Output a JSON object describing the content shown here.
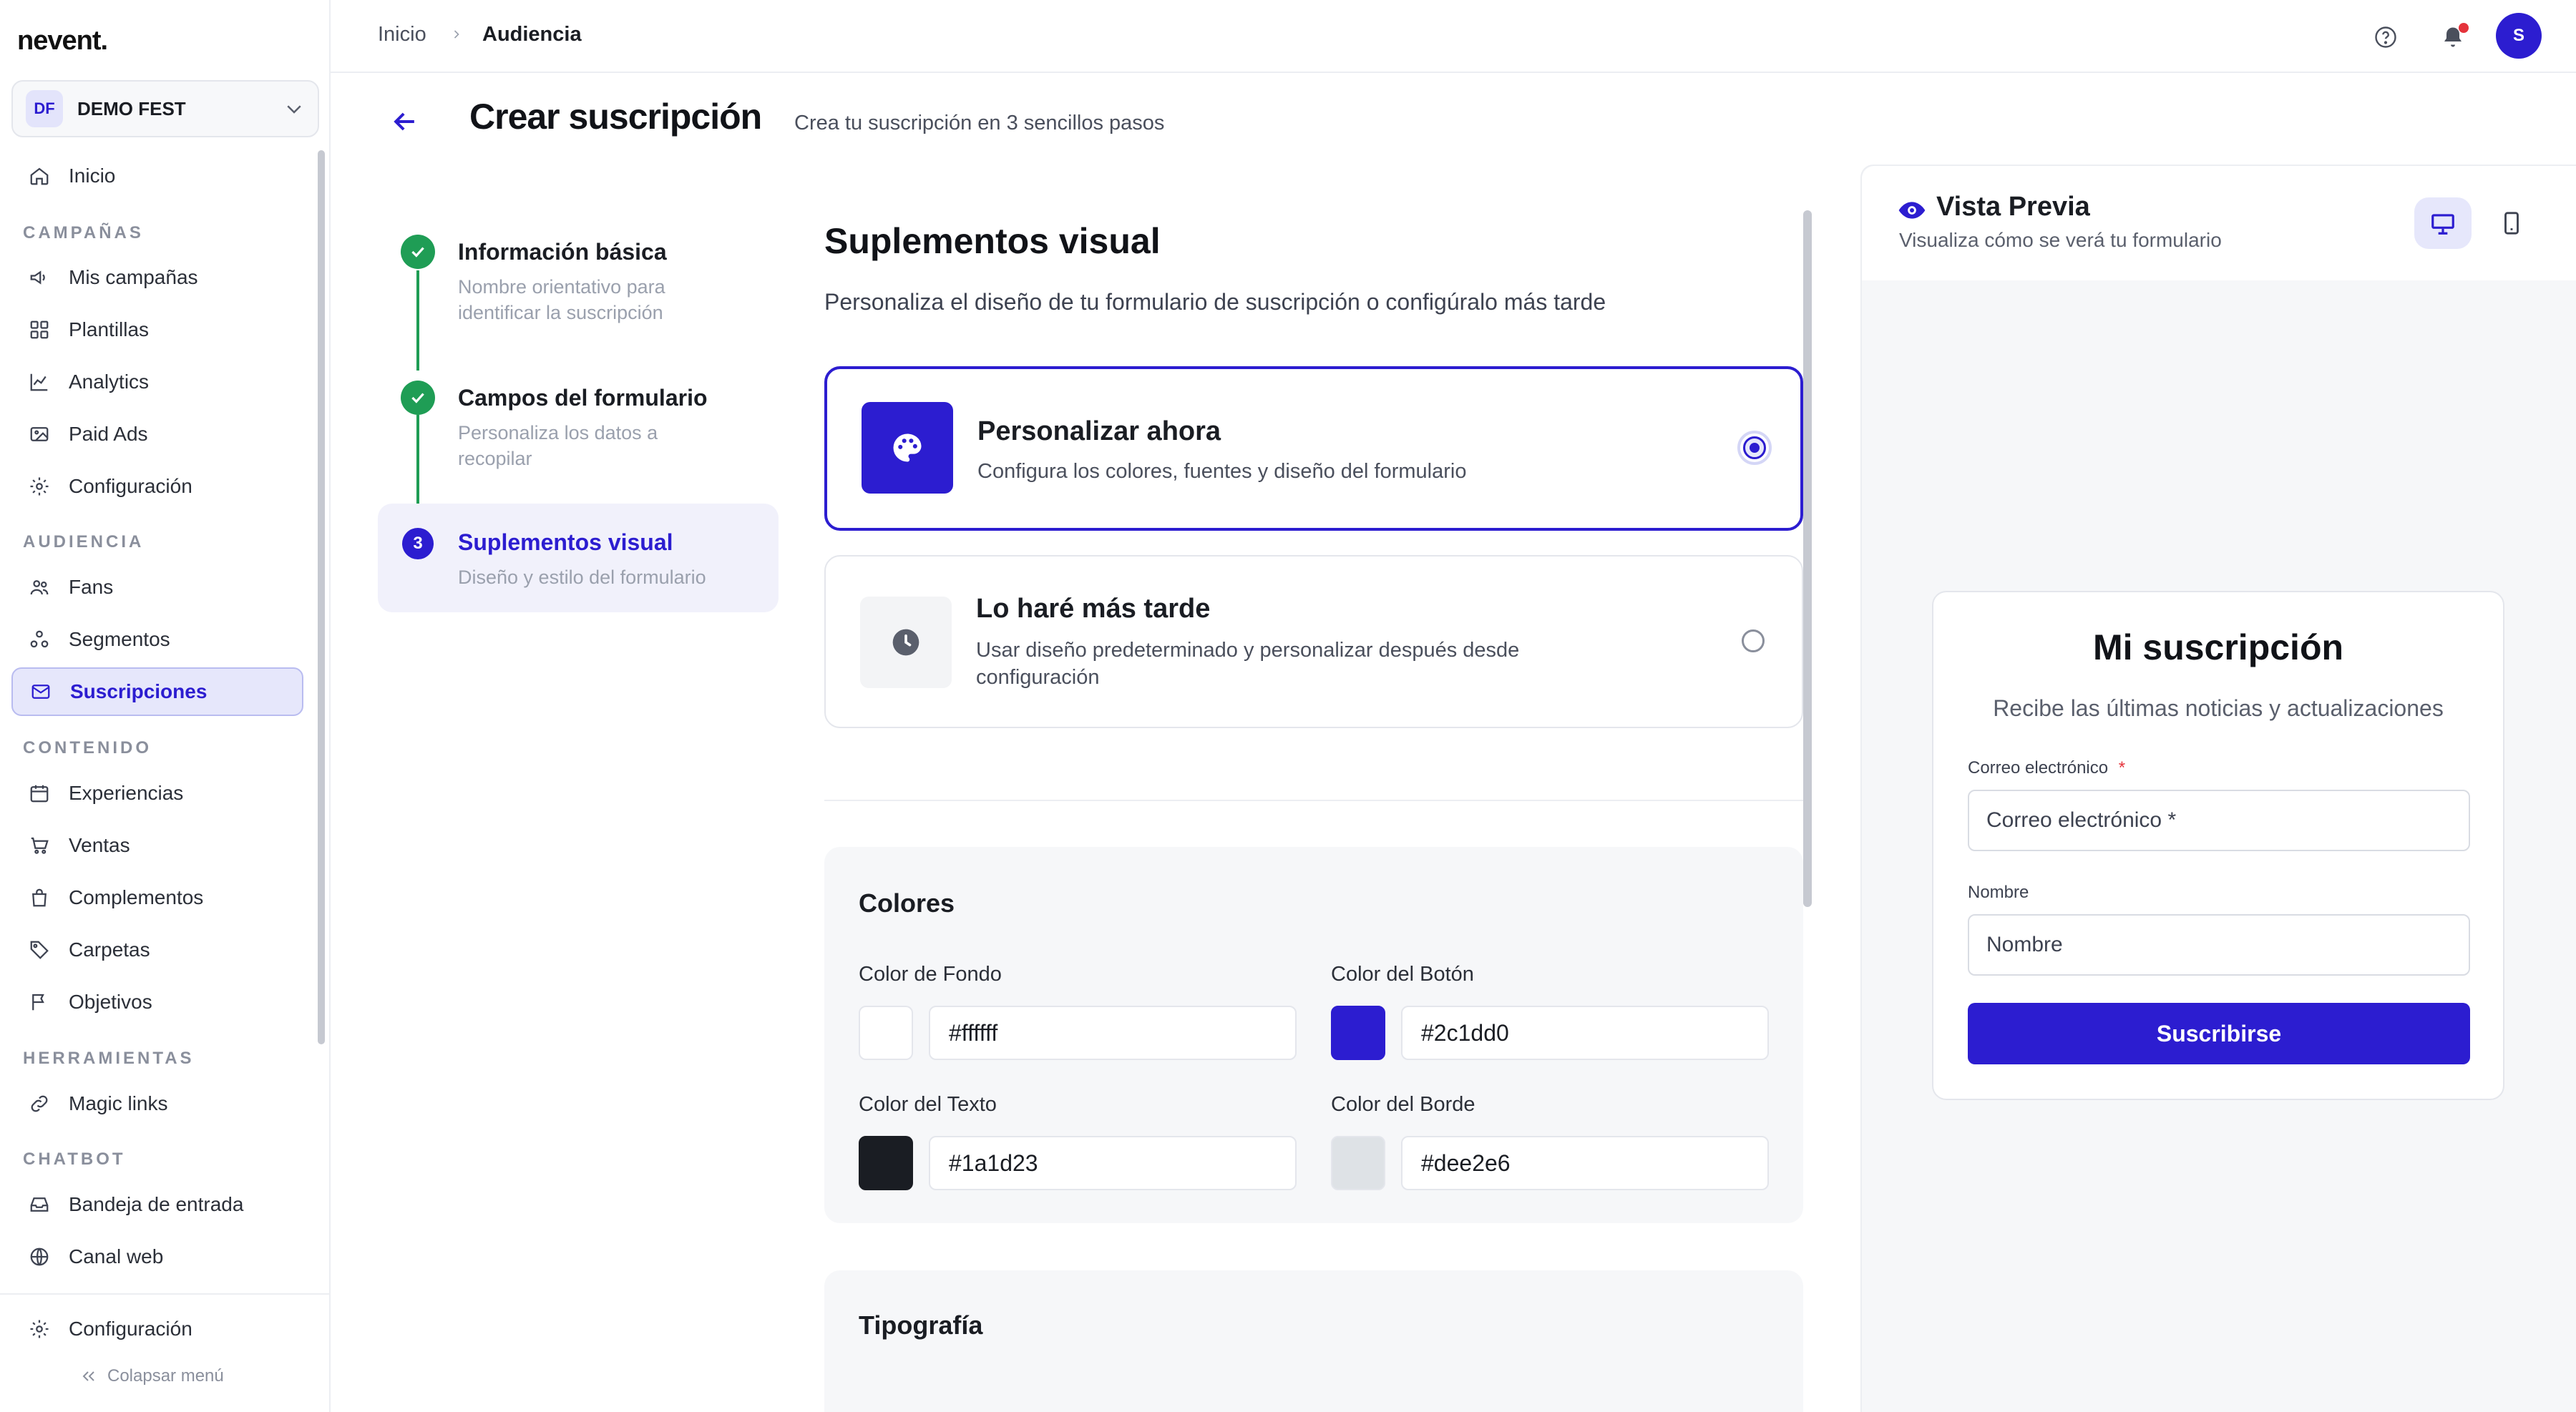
{
  "app": {
    "logo": "nevent."
  },
  "org": {
    "badge": "DF",
    "name": "DEMO FEST"
  },
  "sidebar": {
    "items": [
      {
        "label": "Inicio",
        "icon": "home-icon"
      },
      {
        "label": "Mis campañas",
        "icon": "megaphone-icon"
      },
      {
        "label": "Plantillas",
        "icon": "grid-icon"
      },
      {
        "label": "Analytics",
        "icon": "chart-line-icon"
      },
      {
        "label": "Paid Ads",
        "icon": "image-icon"
      },
      {
        "label": "Configuración",
        "icon": "gear-icon"
      },
      {
        "label": "Fans",
        "icon": "users-icon"
      },
      {
        "label": "Segmentos",
        "icon": "segments-icon"
      },
      {
        "label": "Suscripciones",
        "icon": "mail-icon",
        "active": true
      },
      {
        "label": "Experiencias",
        "icon": "calendar-icon"
      },
      {
        "label": "Ventas",
        "icon": "cart-icon"
      },
      {
        "label": "Complementos",
        "icon": "bag-icon"
      },
      {
        "label": "Carpetas",
        "icon": "tag-icon"
      },
      {
        "label": "Objetivos",
        "icon": "flag-icon"
      },
      {
        "label": "Magic links",
        "icon": "link-icon"
      },
      {
        "label": "Bandeja de entrada",
        "icon": "inbox-icon"
      },
      {
        "label": "Canal web",
        "icon": "globe-icon"
      }
    ],
    "sections": [
      "CAMPAÑAS",
      "AUDIENCIA",
      "CONTENIDO",
      "HERRAMIENTAS",
      "CHATBOT"
    ],
    "settings_label": "Configuración",
    "collapse_label": "Colapsar menú"
  },
  "header": {
    "breadcrumb": [
      "Inicio",
      "Audiencia"
    ]
  },
  "page": {
    "title": "Crear suscripción",
    "subtitle": "Crea tu suscripción en 3 sencillos pasos"
  },
  "steps": [
    {
      "title": "Información básica",
      "desc": "Nombre orientativo para identificar la suscripción",
      "status": "done"
    },
    {
      "title": "Campos del formulario",
      "desc": "Personaliza los datos a recopilar",
      "status": "done"
    },
    {
      "number": "3",
      "title": "Suplementos visual",
      "desc": "Diseño y estilo del formulario",
      "status": "active"
    }
  ],
  "main": {
    "title": "Suplementos visual",
    "description": "Personaliza el diseño de tu formulario de suscripción o configúralo más tarde",
    "options": [
      {
        "title": "Personalizar ahora",
        "desc": "Configura los colores, fuentes y diseño del formulario",
        "selected": true,
        "icon": "palette-icon"
      },
      {
        "title": "Lo haré más tarde",
        "desc": "Usar diseño predeterminado y personalizar después desde configuración",
        "selected": false,
        "icon": "clock-icon"
      }
    ],
    "colors": {
      "title": "Colores",
      "background": {
        "label": "Color de Fondo",
        "value": "#ffffff"
      },
      "button": {
        "label": "Color del Botón",
        "value": "#2c1dd0"
      },
      "text": {
        "label": "Color del Texto",
        "value": "#1a1d23"
      },
      "border": {
        "label": "Color del Borde",
        "value": "#dee2e6"
      }
    },
    "typography": {
      "title": "Tipografía"
    }
  },
  "preview": {
    "title": "Vista Previa",
    "subtitle": "Visualiza cómo se verá tu formulario",
    "form": {
      "title": "Mi suscripción",
      "subtitle": "Recibe las últimas noticias y actualizaciones",
      "email_label": "Correo electrónico",
      "required_mark": "*",
      "email_placeholder": "Correo electrónico *",
      "name_label": "Nombre",
      "name_placeholder": "Nombre",
      "submit": "Suscribirse"
    }
  },
  "theme": {
    "accent": "#2c1dd0",
    "success": "#1f9d55",
    "notification_dot": "#e5333b"
  }
}
